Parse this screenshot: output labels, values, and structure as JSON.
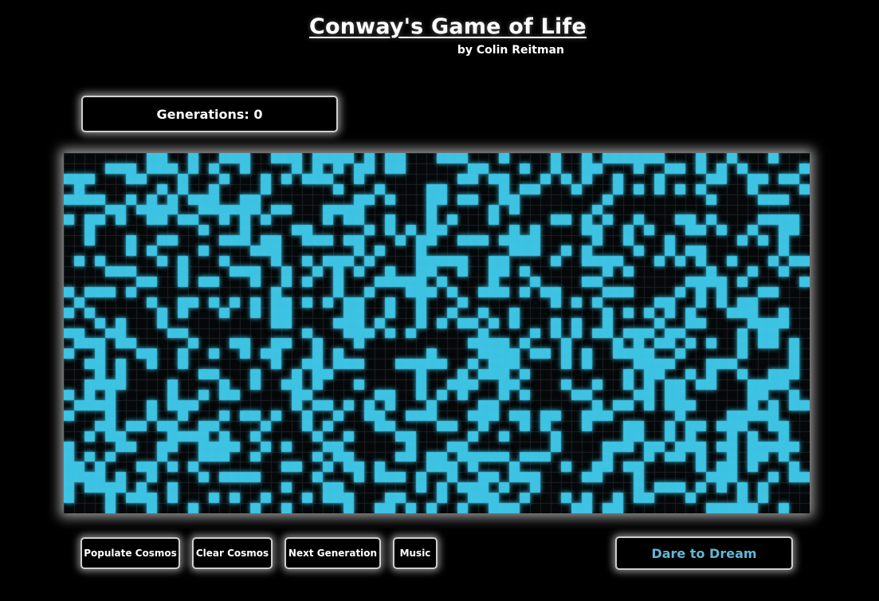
{
  "header": {
    "title": "Conway's Game of Life",
    "byline": "by Colin Reitman"
  },
  "generations": {
    "label": "Generations: 0",
    "count": 0
  },
  "board": {
    "cols": 72,
    "rows": 35,
    "alive_color": "#3ec3e3",
    "dead_color": "#050708",
    "grid_line_color": "#1a2226",
    "seed": 20240611,
    "density": 0.38
  },
  "controls": {
    "populate": "Populate Cosmos",
    "clear": "Clear Cosmos",
    "next": "Next Generation",
    "music": "Music",
    "dream": "Dare to Dream"
  }
}
